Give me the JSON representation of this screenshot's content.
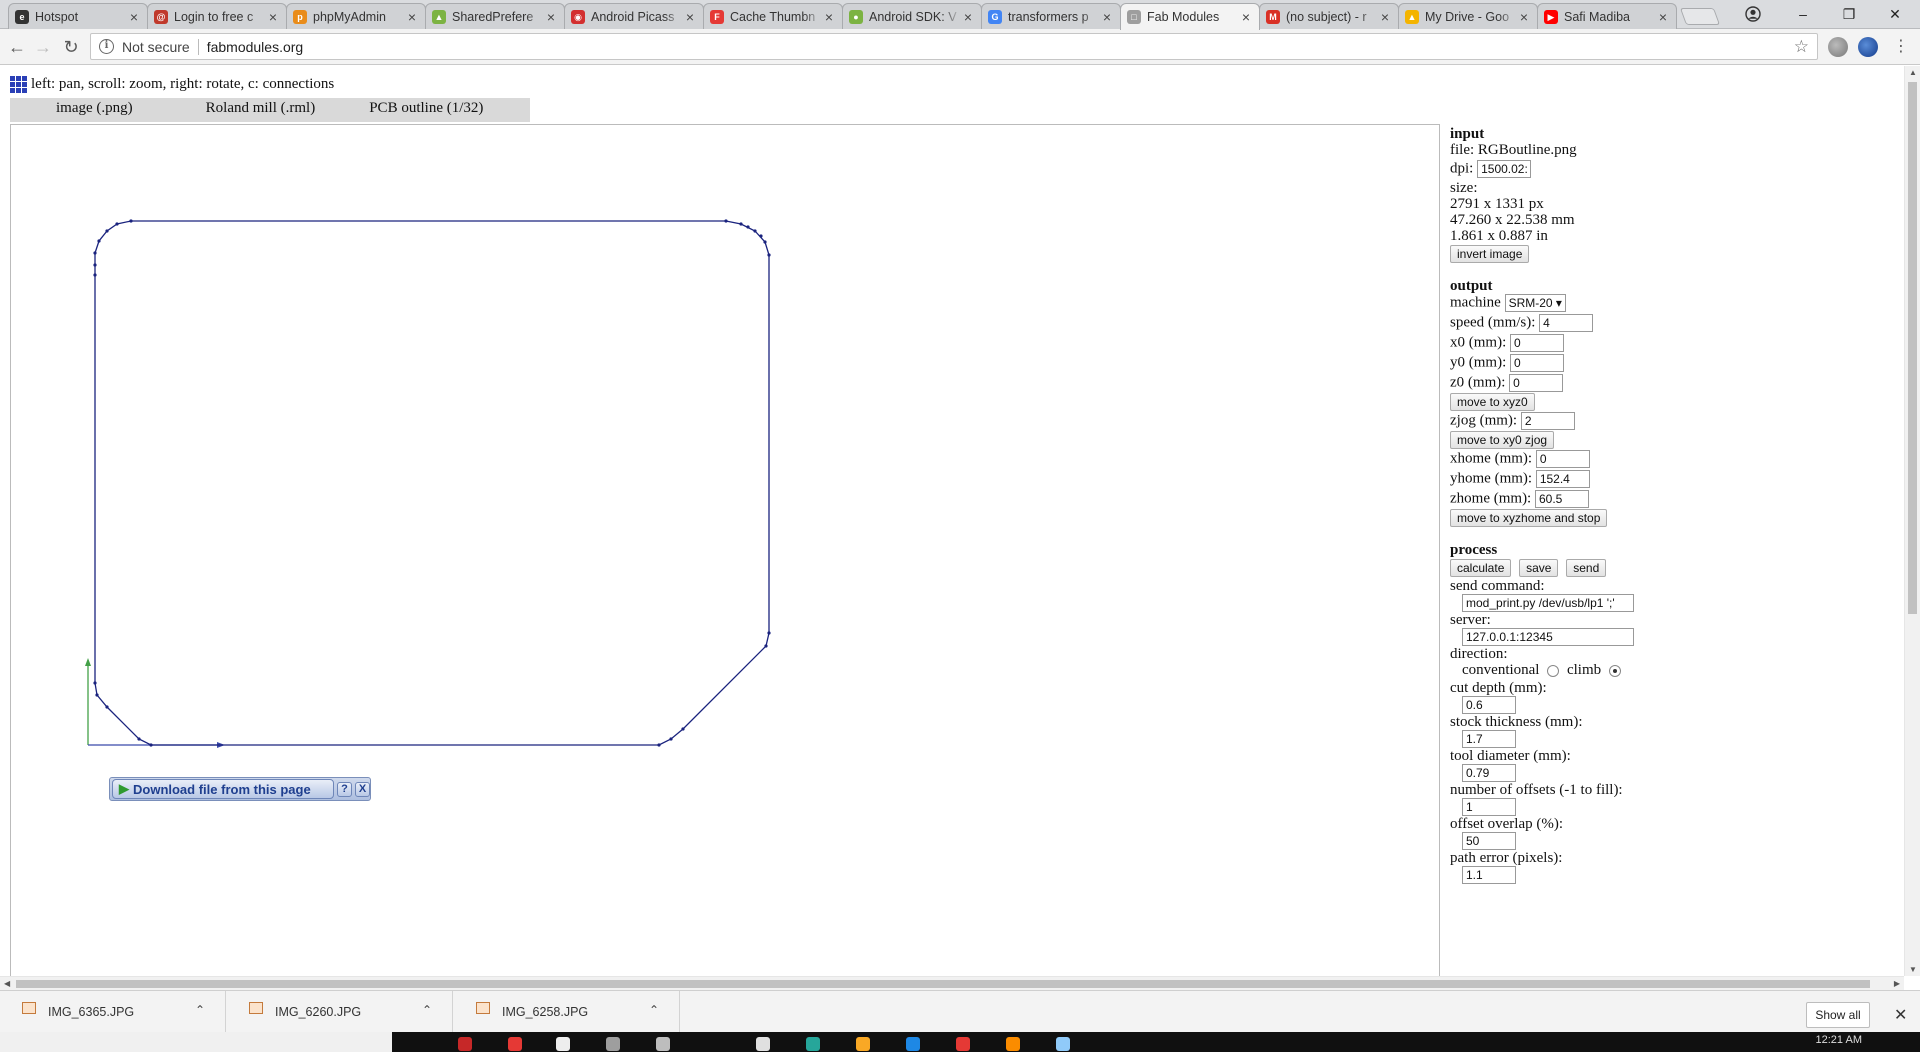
{
  "browser": {
    "tabs": [
      {
        "title": "Hotspot",
        "icon": "hotspot-icon",
        "color": "#333333",
        "glyph": "e",
        "active": false
      },
      {
        "title": "Login to free c",
        "icon": "login-icon",
        "color": "#c0392b",
        "glyph": "@",
        "active": false
      },
      {
        "title": "phpMyAdmin",
        "icon": "phpmyadmin-icon",
        "color": "#e98c1a",
        "glyph": "p",
        "active": false
      },
      {
        "title": "SharedPrefere",
        "icon": "android-icon",
        "color": "#7cb342",
        "glyph": "▲",
        "active": false
      },
      {
        "title": "Android Picass",
        "icon": "picasso-icon",
        "color": "#d32f2f",
        "glyph": "◉",
        "active": false
      },
      {
        "title": "Cache Thumbn",
        "icon": "flipboard-icon",
        "color": "#e53935",
        "glyph": "F",
        "active": false
      },
      {
        "title": "Android SDK: V",
        "icon": "envato-icon",
        "color": "#7cb342",
        "glyph": "●",
        "active": false
      },
      {
        "title": "transformers p",
        "icon": "google-icon",
        "color": "#4285f4",
        "glyph": "G",
        "active": false
      },
      {
        "title": "Fab Modules",
        "icon": "page-icon",
        "color": "#9e9e9e",
        "glyph": "□",
        "active": true
      },
      {
        "title": "(no subject) - r",
        "icon": "gmail-icon",
        "color": "#d93025",
        "glyph": "M",
        "active": false
      },
      {
        "title": "My Drive - Goo",
        "icon": "drive-icon",
        "color": "#f4b400",
        "glyph": "▲",
        "active": false
      },
      {
        "title": "Safi Madiba",
        "icon": "youtube-icon",
        "color": "#ff0000",
        "glyph": "▶",
        "active": false
      }
    ],
    "address": {
      "security_label": "Not secure",
      "url": "fabmodules.org"
    }
  },
  "page": {
    "help_text": "left: pan, scroll: zoom, right: rotate, c: connections",
    "menus": [
      "image (.png)",
      "Roland mill (.rml)",
      "PCB outline (1/32)"
    ],
    "download_bar": {
      "label": "Download file from this page",
      "help": "?",
      "close": "X"
    }
  },
  "panel": {
    "input": {
      "heading": "input",
      "file_label": "file:",
      "file_name": "RGBoutline.png",
      "dpi_label": "dpi:",
      "dpi_value": "1500.02:",
      "size_label": "size:",
      "size_px": "2791 x 1331 px",
      "size_mm": "47.260 x 22.538 mm",
      "size_in": "1.861 x 0.887 in",
      "invert_button": "invert image"
    },
    "output": {
      "heading": "output",
      "machine_label": "machine",
      "machine_value": "SRM-20 ▾",
      "speed_label": "speed (mm/s):",
      "speed_value": "4",
      "x0_label": "x0 (mm):",
      "x0_value": "0",
      "y0_label": "y0 (mm):",
      "y0_value": "0",
      "z0_label": "z0 (mm):",
      "z0_value": "0",
      "move_xyz0_button": "move to xyz0",
      "zjog_label": "zjog (mm):",
      "zjog_value": "2",
      "move_xy0_button": "move to xy0 zjog",
      "xhome_label": "xhome (mm):",
      "xhome_value": "0",
      "yhome_label": "yhome (mm):",
      "yhome_value": "152.4",
      "zhome_label": "zhome (mm):",
      "zhome_value": "60.5",
      "move_home_button": "move to xyzhome and stop"
    },
    "process": {
      "heading": "process",
      "calculate_button": "calculate",
      "save_button": "save",
      "send_button": "send",
      "send_command_label": "send command:",
      "send_command_value": "mod_print.py /dev/usb/lp1 ';'",
      "server_label": "server:",
      "server_value": "127.0.0.1:12345",
      "direction_label": "direction:",
      "conventional_label": "conventional",
      "climb_label": "climb",
      "direction_selected": "climb",
      "cut_depth_label": "cut depth (mm):",
      "cut_depth_value": "0.6",
      "stock_thickness_label": "stock thickness (mm):",
      "stock_thickness_value": "1.7",
      "tool_diameter_label": "tool diameter (mm):",
      "tool_diameter_value": "0.79",
      "offsets_label": "number of offsets (-1 to fill):",
      "offsets_value": "1",
      "overlap_label": "offset overlap (%):",
      "overlap_value": "50",
      "path_error_label": "path error (pixels):",
      "path_error_value": "1.1"
    }
  },
  "downloads": {
    "items": [
      "IMG_6365.JPG",
      "IMG_6260.JPG",
      "IMG_6258.JPG"
    ],
    "show_all": "Show all"
  },
  "taskbar": {
    "clock": "12:21 AM"
  },
  "colors": {
    "toolpath": "#1a237e",
    "axis_x": "#3949ab",
    "axis_y": "#43a047",
    "grid_icon": "#2a3fb6"
  }
}
